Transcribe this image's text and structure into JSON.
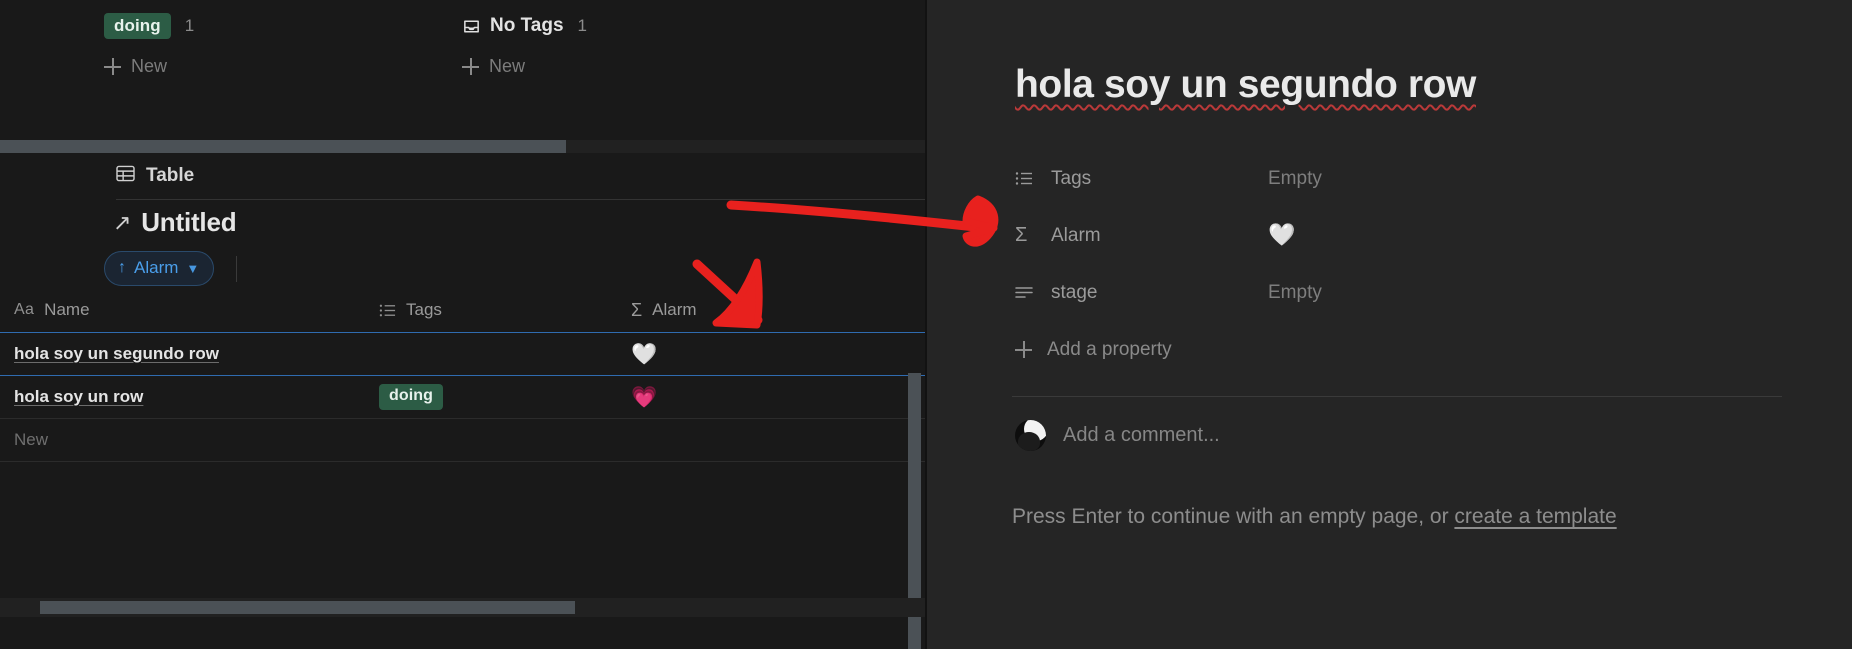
{
  "board": {
    "groups": [
      {
        "type": "tag",
        "label": "doing",
        "count": "1",
        "chip_color": "#2c5c45",
        "new_label": "New",
        "icon": null
      },
      {
        "type": "notag",
        "label": "No Tags",
        "count": "1",
        "chip_color": null,
        "new_label": "New",
        "icon": "inbox-icon"
      }
    ]
  },
  "table_view": {
    "tab_label": "Table",
    "tab_icon": "table-icon",
    "database_title": "Untitled",
    "database_title_icon": "arrow-up-right-icon",
    "filter": {
      "label": "Alarm",
      "sort_icon": "arrow-up-icon",
      "chevron_icon": "chevron-down-icon",
      "accent": "#4a9eea"
    },
    "columns": [
      {
        "label": "Name",
        "icon": "aa-text-icon"
      },
      {
        "label": "Tags",
        "icon": "multi-select-icon"
      },
      {
        "label": "Alarm",
        "icon": "sigma-formula-icon"
      }
    ],
    "rows": [
      {
        "name": "hola soy un segundo row",
        "tags": "",
        "alarm": "🤍",
        "alarm_state": "gray",
        "selected": true
      },
      {
        "name": "hola soy un row",
        "tags": "doing",
        "alarm": "💗",
        "alarm_state": "pink",
        "selected": false
      }
    ],
    "new_row_label": "New"
  },
  "peek_page": {
    "title": "hola soy un segundo row",
    "properties": [
      {
        "label": "Tags",
        "icon": "multi-select-icon",
        "value": "Empty",
        "value_type": "text"
      },
      {
        "label": "Alarm",
        "icon": "sigma-formula-icon",
        "value": "🤍",
        "value_type": "emoji"
      },
      {
        "label": "stage",
        "icon": "text-lines-icon",
        "value": "Empty",
        "value_type": "text"
      }
    ],
    "add_property_label": "Add a property",
    "add_property_icon": "plus-icon",
    "comment": {
      "placeholder": "Add a comment...",
      "avatar_icon": "user-avatar"
    },
    "empty_hint": {
      "text": "Press Enter to continue with an empty page, or ",
      "link": "create a template"
    }
  },
  "annotations": {
    "color": "#e8211e",
    "marks": [
      {
        "name": "arrow-to-peek-panel",
        "shape": "right-arrow"
      },
      {
        "name": "arrow-to-alarm-column",
        "shape": "down-right-arrow"
      }
    ]
  }
}
